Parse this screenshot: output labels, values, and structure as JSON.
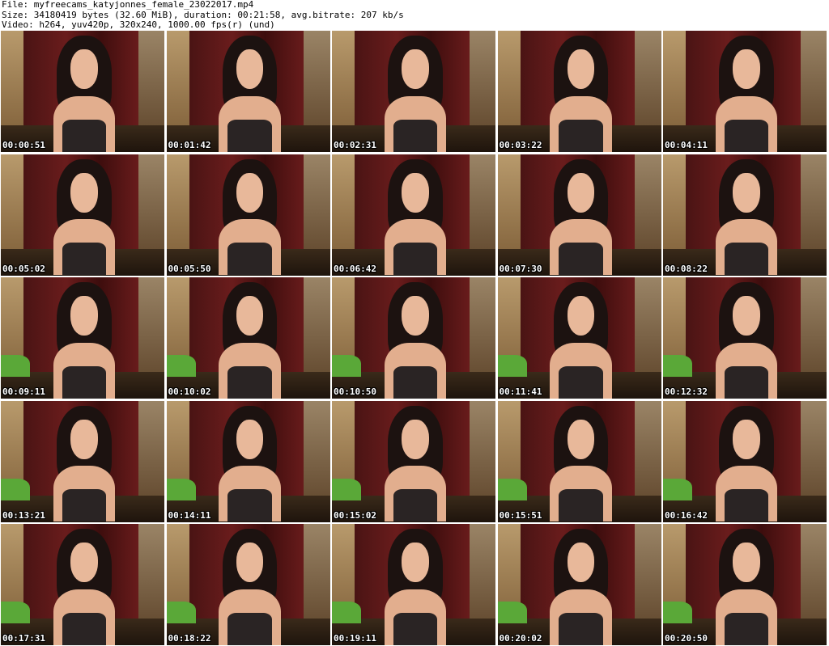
{
  "header": {
    "file": "File: myfreecams_katyjonnes_female_23022017.mp4",
    "size": "Size: 34180419 bytes (32.60 MiB), duration: 00:21:58, avg.bitrate: 207 kb/s",
    "video": "Video: h264, yuv420p, 320x240, 1000.00 fps(r) (und)"
  },
  "thumbnails": [
    {
      "timestamp": "00:00:51"
    },
    {
      "timestamp": "00:01:42"
    },
    {
      "timestamp": "00:02:31"
    },
    {
      "timestamp": "00:03:22"
    },
    {
      "timestamp": "00:04:11"
    },
    {
      "timestamp": "00:05:02"
    },
    {
      "timestamp": "00:05:50"
    },
    {
      "timestamp": "00:06:42"
    },
    {
      "timestamp": "00:07:30"
    },
    {
      "timestamp": "00:08:22"
    },
    {
      "timestamp": "00:09:11"
    },
    {
      "timestamp": "00:10:02"
    },
    {
      "timestamp": "00:10:50"
    },
    {
      "timestamp": "00:11:41"
    },
    {
      "timestamp": "00:12:32"
    },
    {
      "timestamp": "00:13:21"
    },
    {
      "timestamp": "00:14:11"
    },
    {
      "timestamp": "00:15:02"
    },
    {
      "timestamp": "00:15:51"
    },
    {
      "timestamp": "00:16:42"
    },
    {
      "timestamp": "00:17:31"
    },
    {
      "timestamp": "00:18:22"
    },
    {
      "timestamp": "00:19:11"
    },
    {
      "timestamp": "00:20:02"
    },
    {
      "timestamp": "00:20:50"
    }
  ]
}
